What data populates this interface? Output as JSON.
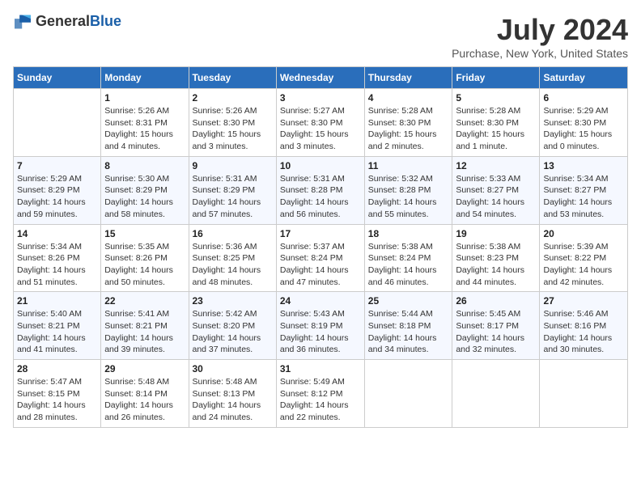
{
  "logo": {
    "general": "General",
    "blue": "Blue"
  },
  "title": {
    "month_year": "July 2024",
    "location": "Purchase, New York, United States"
  },
  "days_of_week": [
    "Sunday",
    "Monday",
    "Tuesday",
    "Wednesday",
    "Thursday",
    "Friday",
    "Saturday"
  ],
  "weeks": [
    [
      {
        "day": "",
        "sunrise": "",
        "sunset": "",
        "daylight": ""
      },
      {
        "day": "1",
        "sunrise": "Sunrise: 5:26 AM",
        "sunset": "Sunset: 8:31 PM",
        "daylight": "Daylight: 15 hours and 4 minutes."
      },
      {
        "day": "2",
        "sunrise": "Sunrise: 5:26 AM",
        "sunset": "Sunset: 8:30 PM",
        "daylight": "Daylight: 15 hours and 3 minutes."
      },
      {
        "day": "3",
        "sunrise": "Sunrise: 5:27 AM",
        "sunset": "Sunset: 8:30 PM",
        "daylight": "Daylight: 15 hours and 3 minutes."
      },
      {
        "day": "4",
        "sunrise": "Sunrise: 5:28 AM",
        "sunset": "Sunset: 8:30 PM",
        "daylight": "Daylight: 15 hours and 2 minutes."
      },
      {
        "day": "5",
        "sunrise": "Sunrise: 5:28 AM",
        "sunset": "Sunset: 8:30 PM",
        "daylight": "Daylight: 15 hours and 1 minute."
      },
      {
        "day": "6",
        "sunrise": "Sunrise: 5:29 AM",
        "sunset": "Sunset: 8:30 PM",
        "daylight": "Daylight: 15 hours and 0 minutes."
      }
    ],
    [
      {
        "day": "7",
        "sunrise": "Sunrise: 5:29 AM",
        "sunset": "Sunset: 8:29 PM",
        "daylight": "Daylight: 14 hours and 59 minutes."
      },
      {
        "day": "8",
        "sunrise": "Sunrise: 5:30 AM",
        "sunset": "Sunset: 8:29 PM",
        "daylight": "Daylight: 14 hours and 58 minutes."
      },
      {
        "day": "9",
        "sunrise": "Sunrise: 5:31 AM",
        "sunset": "Sunset: 8:29 PM",
        "daylight": "Daylight: 14 hours and 57 minutes."
      },
      {
        "day": "10",
        "sunrise": "Sunrise: 5:31 AM",
        "sunset": "Sunset: 8:28 PM",
        "daylight": "Daylight: 14 hours and 56 minutes."
      },
      {
        "day": "11",
        "sunrise": "Sunrise: 5:32 AM",
        "sunset": "Sunset: 8:28 PM",
        "daylight": "Daylight: 14 hours and 55 minutes."
      },
      {
        "day": "12",
        "sunrise": "Sunrise: 5:33 AM",
        "sunset": "Sunset: 8:27 PM",
        "daylight": "Daylight: 14 hours and 54 minutes."
      },
      {
        "day": "13",
        "sunrise": "Sunrise: 5:34 AM",
        "sunset": "Sunset: 8:27 PM",
        "daylight": "Daylight: 14 hours and 53 minutes."
      }
    ],
    [
      {
        "day": "14",
        "sunrise": "Sunrise: 5:34 AM",
        "sunset": "Sunset: 8:26 PM",
        "daylight": "Daylight: 14 hours and 51 minutes."
      },
      {
        "day": "15",
        "sunrise": "Sunrise: 5:35 AM",
        "sunset": "Sunset: 8:26 PM",
        "daylight": "Daylight: 14 hours and 50 minutes."
      },
      {
        "day": "16",
        "sunrise": "Sunrise: 5:36 AM",
        "sunset": "Sunset: 8:25 PM",
        "daylight": "Daylight: 14 hours and 48 minutes."
      },
      {
        "day": "17",
        "sunrise": "Sunrise: 5:37 AM",
        "sunset": "Sunset: 8:24 PM",
        "daylight": "Daylight: 14 hours and 47 minutes."
      },
      {
        "day": "18",
        "sunrise": "Sunrise: 5:38 AM",
        "sunset": "Sunset: 8:24 PM",
        "daylight": "Daylight: 14 hours and 46 minutes."
      },
      {
        "day": "19",
        "sunrise": "Sunrise: 5:38 AM",
        "sunset": "Sunset: 8:23 PM",
        "daylight": "Daylight: 14 hours and 44 minutes."
      },
      {
        "day": "20",
        "sunrise": "Sunrise: 5:39 AM",
        "sunset": "Sunset: 8:22 PM",
        "daylight": "Daylight: 14 hours and 42 minutes."
      }
    ],
    [
      {
        "day": "21",
        "sunrise": "Sunrise: 5:40 AM",
        "sunset": "Sunset: 8:21 PM",
        "daylight": "Daylight: 14 hours and 41 minutes."
      },
      {
        "day": "22",
        "sunrise": "Sunrise: 5:41 AM",
        "sunset": "Sunset: 8:21 PM",
        "daylight": "Daylight: 14 hours and 39 minutes."
      },
      {
        "day": "23",
        "sunrise": "Sunrise: 5:42 AM",
        "sunset": "Sunset: 8:20 PM",
        "daylight": "Daylight: 14 hours and 37 minutes."
      },
      {
        "day": "24",
        "sunrise": "Sunrise: 5:43 AM",
        "sunset": "Sunset: 8:19 PM",
        "daylight": "Daylight: 14 hours and 36 minutes."
      },
      {
        "day": "25",
        "sunrise": "Sunrise: 5:44 AM",
        "sunset": "Sunset: 8:18 PM",
        "daylight": "Daylight: 14 hours and 34 minutes."
      },
      {
        "day": "26",
        "sunrise": "Sunrise: 5:45 AM",
        "sunset": "Sunset: 8:17 PM",
        "daylight": "Daylight: 14 hours and 32 minutes."
      },
      {
        "day": "27",
        "sunrise": "Sunrise: 5:46 AM",
        "sunset": "Sunset: 8:16 PM",
        "daylight": "Daylight: 14 hours and 30 minutes."
      }
    ],
    [
      {
        "day": "28",
        "sunrise": "Sunrise: 5:47 AM",
        "sunset": "Sunset: 8:15 PM",
        "daylight": "Daylight: 14 hours and 28 minutes."
      },
      {
        "day": "29",
        "sunrise": "Sunrise: 5:48 AM",
        "sunset": "Sunset: 8:14 PM",
        "daylight": "Daylight: 14 hours and 26 minutes."
      },
      {
        "day": "30",
        "sunrise": "Sunrise: 5:48 AM",
        "sunset": "Sunset: 8:13 PM",
        "daylight": "Daylight: 14 hours and 24 minutes."
      },
      {
        "day": "31",
        "sunrise": "Sunrise: 5:49 AM",
        "sunset": "Sunset: 8:12 PM",
        "daylight": "Daylight: 14 hours and 22 minutes."
      },
      {
        "day": "",
        "sunrise": "",
        "sunset": "",
        "daylight": ""
      },
      {
        "day": "",
        "sunrise": "",
        "sunset": "",
        "daylight": ""
      },
      {
        "day": "",
        "sunrise": "",
        "sunset": "",
        "daylight": ""
      }
    ]
  ]
}
